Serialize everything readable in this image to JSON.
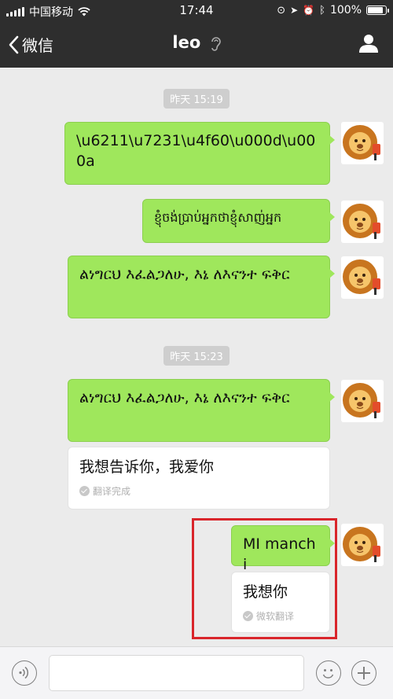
{
  "status_bar": {
    "carrier": "中国移动",
    "time": "17:44",
    "battery": "100%",
    "battery_level": 1.0
  },
  "nav": {
    "back_label": "微信",
    "title": "leo"
  },
  "chat": {
    "timestamps": [
      "昨天 15:19",
      "昨天 15:23"
    ],
    "messages": [
      {
        "text": "\\u6211\\u7231\\u4f60\\u000d\\u000a"
      },
      {
        "text": "ខ្ញុំចង់ប្រាប់អ្នកថាខ្ញុំសាញ់អ្នក"
      },
      {
        "text": "ልነግርህ እፈልጋለሁ, እኔ ለእናንተ ፍቅር"
      },
      {
        "text": "ልነግርህ እፈልጋለሁ, እኔ ለእናንተ ፍቅር"
      },
      {
        "text": "MI manchi"
      }
    ],
    "translations": [
      {
        "text": "我想告诉你，我爱你",
        "status": "翻译完成"
      },
      {
        "text": "我想你",
        "status": "微软翻译"
      }
    ]
  },
  "colors": {
    "sent_bubble": "#9fe75c",
    "highlight": "#d9252b",
    "nav_bg": "#2e2e2e"
  },
  "icons": [
    "signal-icon",
    "wifi-icon",
    "battery-icon",
    "back-chevron-icon",
    "ear-icon",
    "profile-icon",
    "voice-icon",
    "emoji-icon",
    "plus-icon",
    "lion-avatar"
  ]
}
